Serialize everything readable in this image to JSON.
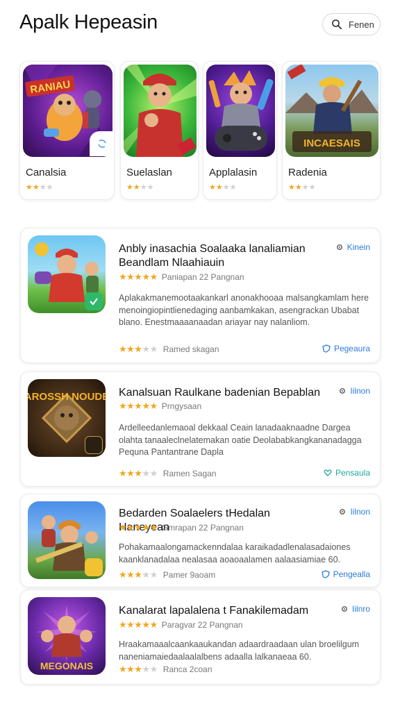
{
  "header": {
    "title": "Apalk Hepeasin",
    "search_label": "Fenen",
    "search_icon": "search-icon"
  },
  "featured": [
    {
      "name": "Canalsia",
      "rating": 2,
      "art_text": "RANIAU",
      "badge_icon": "sync-icon"
    },
    {
      "name": "Suelaslan",
      "rating": 2,
      "art_text": "",
      "badge_icon": ""
    },
    {
      "name": "Applalasin",
      "rating": 2,
      "art_text": "",
      "badge_icon": ""
    },
    {
      "name": "Radenia",
      "rating": 2,
      "art_text": "INCAESAIS",
      "badge_icon": ""
    }
  ],
  "list": [
    {
      "title": "Anbly inasachia Soalaaka lanaliamian Beandlam Nlaahiauin",
      "rating_text": "Paniapan 22 Pangnan",
      "rating": 5,
      "desc": "Aplakakmanemootaakankarl anonakhooaa malsangkamlam here menoingiopintlienedaging aanbamkakan, asengrackan Ubabat blano. Enestmaaaanaadan ariayar nay nalanliom.",
      "bottom_label": "Ramed skagan",
      "bottom_rating": 3,
      "action_label": "Pegeaura",
      "action_icon": "shield-icon",
      "side_label": "Kinein",
      "side_icon": "gear-icon",
      "art_text": ""
    },
    {
      "title": "Kanalsuan Raulkane badenian Bepablan",
      "rating_text": "Prngysaan",
      "rating": 5,
      "desc": "Ardelleedanlemaoal dekkaal Ceain lanadaaknaadne Dargea olahta tanaaleclnelatemakan oatie Deolababkangkananadagga Pequna Pantantrane Dapla",
      "bottom_label": "Ramen Sagan",
      "bottom_rating": 3,
      "action_label": "Pensaula",
      "action_icon": "heart-icon",
      "side_label": "Iilnon",
      "side_icon": "gear-icon",
      "art_text": "DAROSSH NOUDER"
    },
    {
      "title": "Bedarden Soalaelers tHedalan Haneyean",
      "rating_text": "Gmrapan 22 Pangnan",
      "rating": 5,
      "desc": "Pohakamaalongamackenndalaa karaikadadlenalasadaiones kaanklanadalaa nealasaa aoaoaalamen aalaasiamiae 60.",
      "bottom_label": "Pamer 9aoam",
      "bottom_rating": 3,
      "action_label": "Pengealla",
      "action_icon": "shield-icon",
      "side_label": "Iilnon",
      "side_icon": "gear-icon",
      "art_text": ""
    },
    {
      "title": "Kanalarat lapalalena t Fanakilemadam",
      "rating_text": "Paragvar 22 Pangnan",
      "rating": 5,
      "desc": "Hraakamaaalcaankaaukandan adaardraadaan ulan broelilgum naneniamaiedaalaalalbens adaalla lalkanaeaa 60.",
      "bottom_label": "Ranca 2coan",
      "bottom_rating": 3,
      "action_label": "",
      "action_icon": "",
      "side_label": "Iilnro",
      "side_icon": "gear-icon",
      "art_text": "MEGONAIS"
    }
  ],
  "colors": {
    "star": "#f2a61c",
    "star_off": "#cfcfcf",
    "link": "#2b7bd9"
  }
}
